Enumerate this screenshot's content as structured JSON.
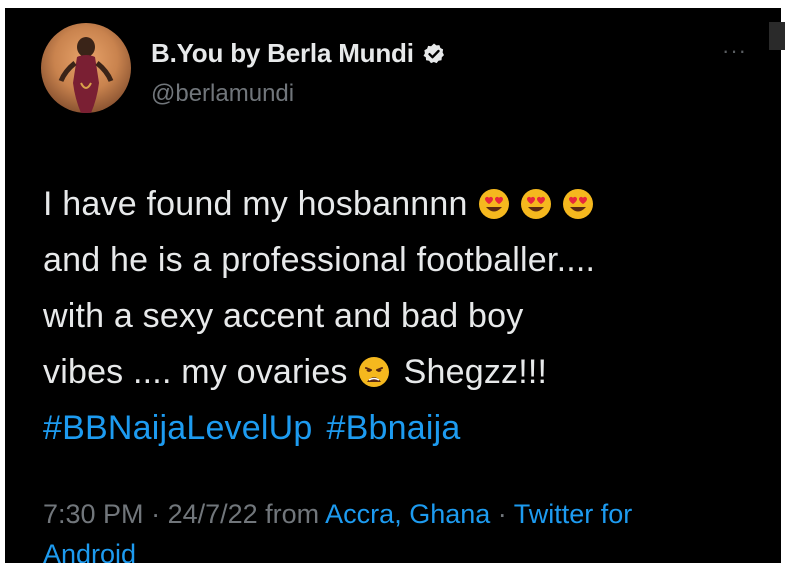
{
  "author": {
    "display_name": "B.You by Berla Mundi",
    "handle": "@berlamundi",
    "verified_icon": "verified-badge-icon",
    "more_label": "···"
  },
  "tweet": {
    "line1_text": "I have found my hosbannnn",
    "line1_emojis": [
      "heart-eyes-emoji",
      "heart-eyes-emoji",
      "heart-eyes-emoji"
    ],
    "line2_text": "and he is a professional footballer....",
    "line3_text": "with a sexy accent and bad boy",
    "line4_text_before": "vibes .... my ovaries",
    "line4_emoji": "weary-face-emoji",
    "line4_text_after": "Shegzz!!!",
    "hashtags": [
      "#BBNaijaLevelUp",
      "#Bbnaija"
    ]
  },
  "meta": {
    "time": "7:30 PM",
    "sep1": " · ",
    "date": "24/7/22",
    "from_label": " from ",
    "location": "Accra, Ghana",
    "sep2": " · ",
    "client_part1": "Twitter for",
    "client_part2": "Android"
  },
  "colors": {
    "background": "#000000",
    "text": "#e7e9ea",
    "muted": "#71767b",
    "link": "#1d9bf0"
  }
}
